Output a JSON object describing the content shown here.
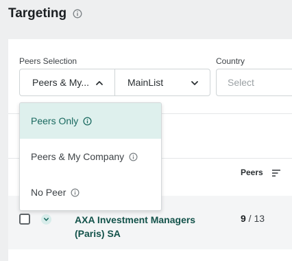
{
  "page": {
    "title": "Targeting"
  },
  "filters": {
    "peers_label": "Peers Selection",
    "peers_value": "Peers & My...",
    "list_value": "MainList",
    "country_label": "Country",
    "country_placeholder": "Select"
  },
  "dropdown": {
    "options": [
      {
        "label": "Peers Only",
        "selected": true
      },
      {
        "label": "Peers & My Company",
        "selected": false
      },
      {
        "label": "No Peer",
        "selected": false
      }
    ]
  },
  "table": {
    "columns": {
      "peers": "Peers"
    },
    "rows": [
      {
        "name": "AXA Investment Managers (Paris) SA",
        "peers_matched": "9",
        "peers_separator": " / ",
        "peers_total": "13"
      }
    ]
  },
  "colors": {
    "accent": "#19695f",
    "selected_bg": "#def0ed",
    "link": "#13524a"
  },
  "icons": [
    "info-icon",
    "chevron-up-icon",
    "chevron-down-icon",
    "sort-icon"
  ]
}
